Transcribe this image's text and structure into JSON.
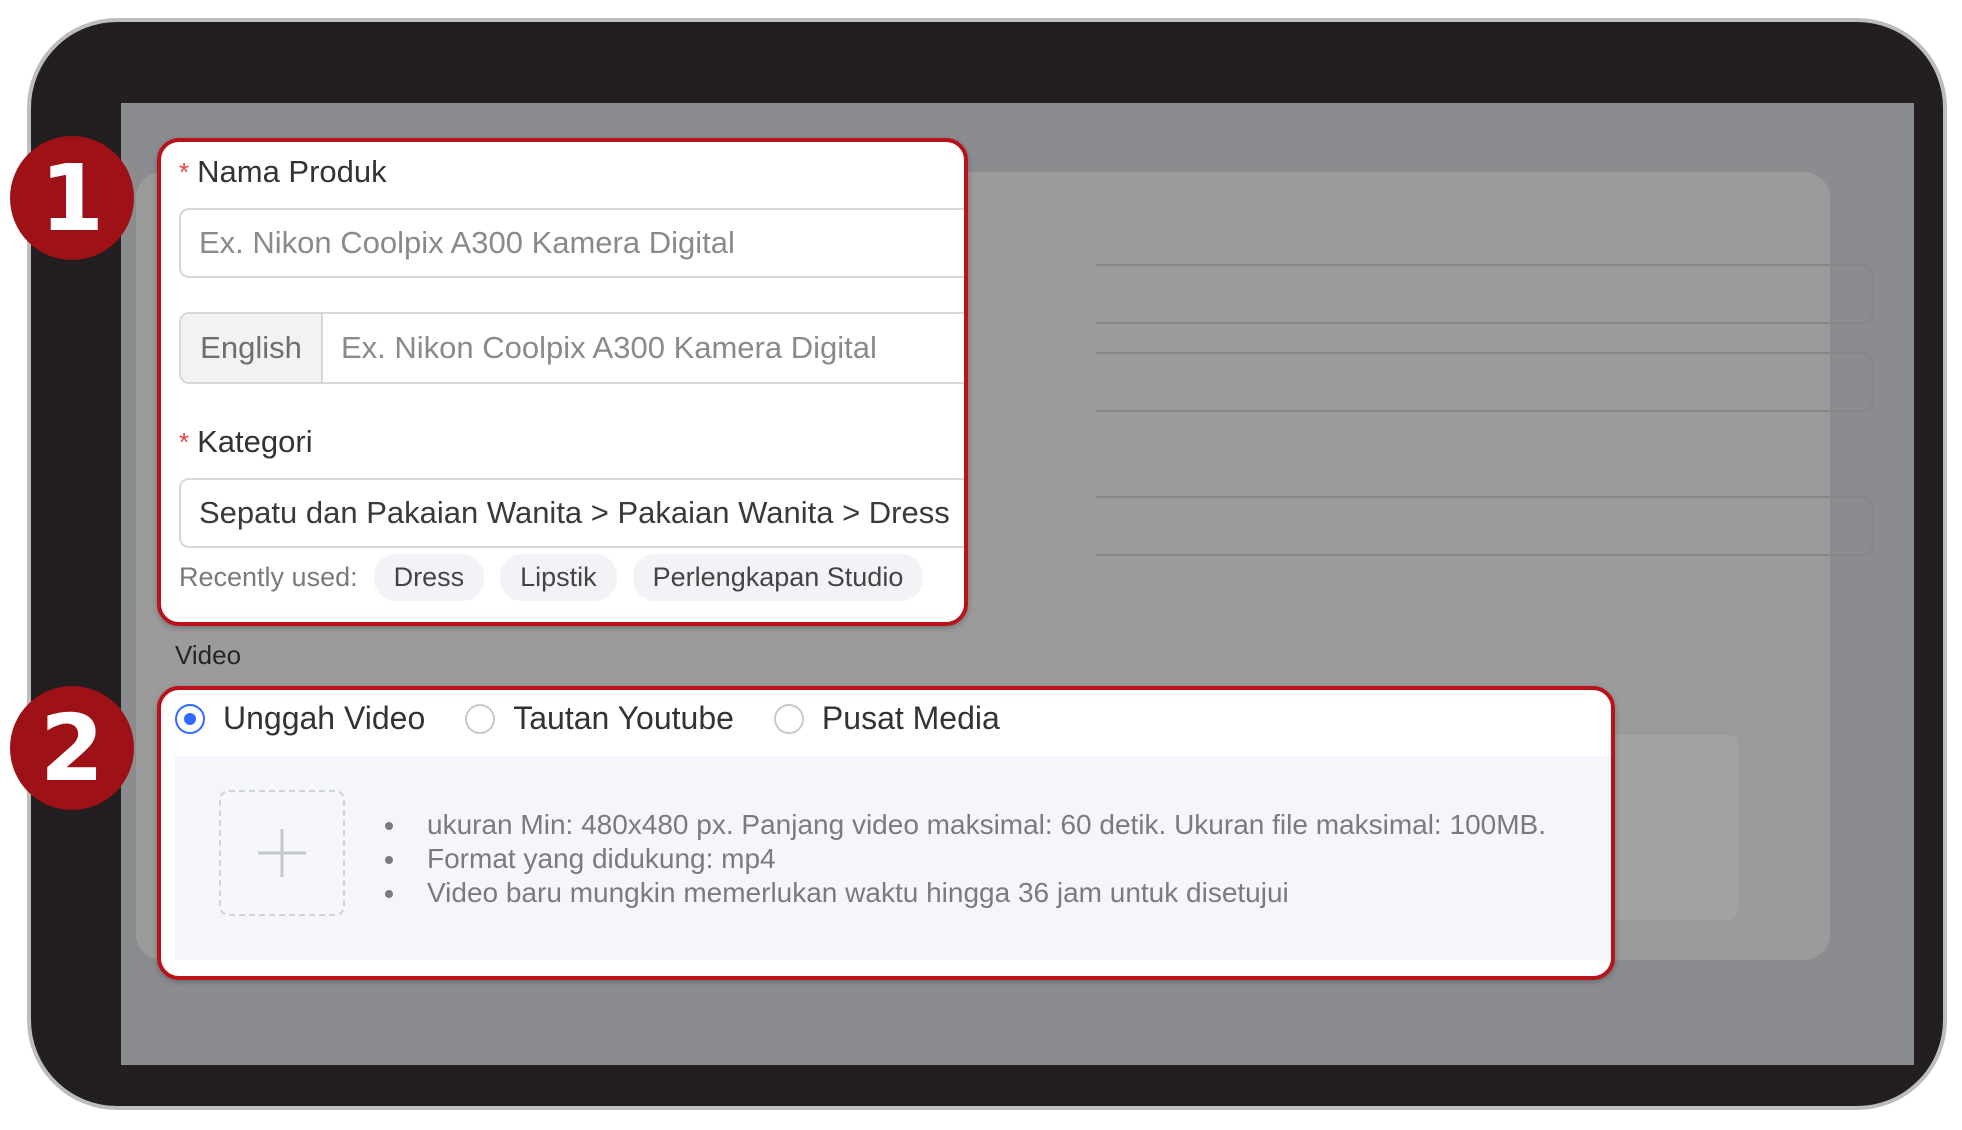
{
  "badges": {
    "first": "1",
    "second": "2"
  },
  "product": {
    "name_label": "Nama Produk",
    "required_mark": "*",
    "name_placeholder": "Ex. Nikon Coolpix A300 Kamera Digital",
    "lang_addon": "English",
    "name_en_placeholder": "Ex. Nikon Coolpix A300 Kamera Digital"
  },
  "category": {
    "label": "Kategori",
    "value": "Sepatu dan Pakaian Wanita > Pakaian Wanita > Dress",
    "recent_label": "Recently used:",
    "recent_items": [
      "Dress",
      "Lipstik",
      "Perlengkapan Studio"
    ]
  },
  "video": {
    "section_label": "Video",
    "options": [
      "Unggah Video",
      "Tautan Youtube",
      "Pusat Media"
    ],
    "selected_option": "Unggah Video",
    "rules": [
      "ukuran Min: 480x480 px. Panjang video maksimal: 60 detik. Ukuran file maksimal: 100MB.",
      "Format yang didukung: mp4",
      "Video baru mungkin memerlukan waktu hingga 36 jam untuk disetujui"
    ]
  },
  "colors": {
    "highlight_border": "#b8121b",
    "badge": "#9e1116",
    "radio_selected": "#2f6bff",
    "required": "#e04545"
  },
  "icons": {
    "upload": "plus-icon"
  }
}
